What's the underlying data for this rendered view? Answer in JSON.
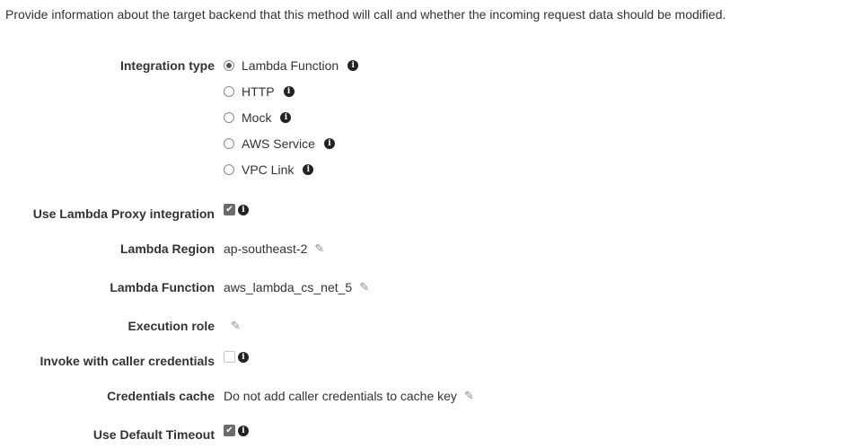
{
  "intro_text": "Provide information about the target backend that this method will call and whether the incoming request data should be modified.",
  "integration_type": {
    "label": "Integration type",
    "selected": "Lambda Function",
    "options": [
      "Lambda Function",
      "HTTP",
      "Mock",
      "AWS Service",
      "VPC Link"
    ]
  },
  "lambda_proxy": {
    "label": "Use Lambda Proxy integration",
    "checked": true
  },
  "lambda_region": {
    "label": "Lambda Region",
    "value": "ap-southeast-2"
  },
  "lambda_function": {
    "label": "Lambda Function",
    "value": "aws_lambda_cs_net_5"
  },
  "execution_role": {
    "label": "Execution role",
    "value": ""
  },
  "caller_credentials": {
    "label": "Invoke with caller credentials",
    "checked": false
  },
  "credentials_cache": {
    "label": "Credentials cache",
    "value": "Do not add caller credentials to cache key"
  },
  "default_timeout": {
    "label": "Use Default Timeout",
    "checked": true
  },
  "icons": {
    "info": "info-icon",
    "edit": "pencil-icon",
    "check": "checkmark-icon"
  }
}
